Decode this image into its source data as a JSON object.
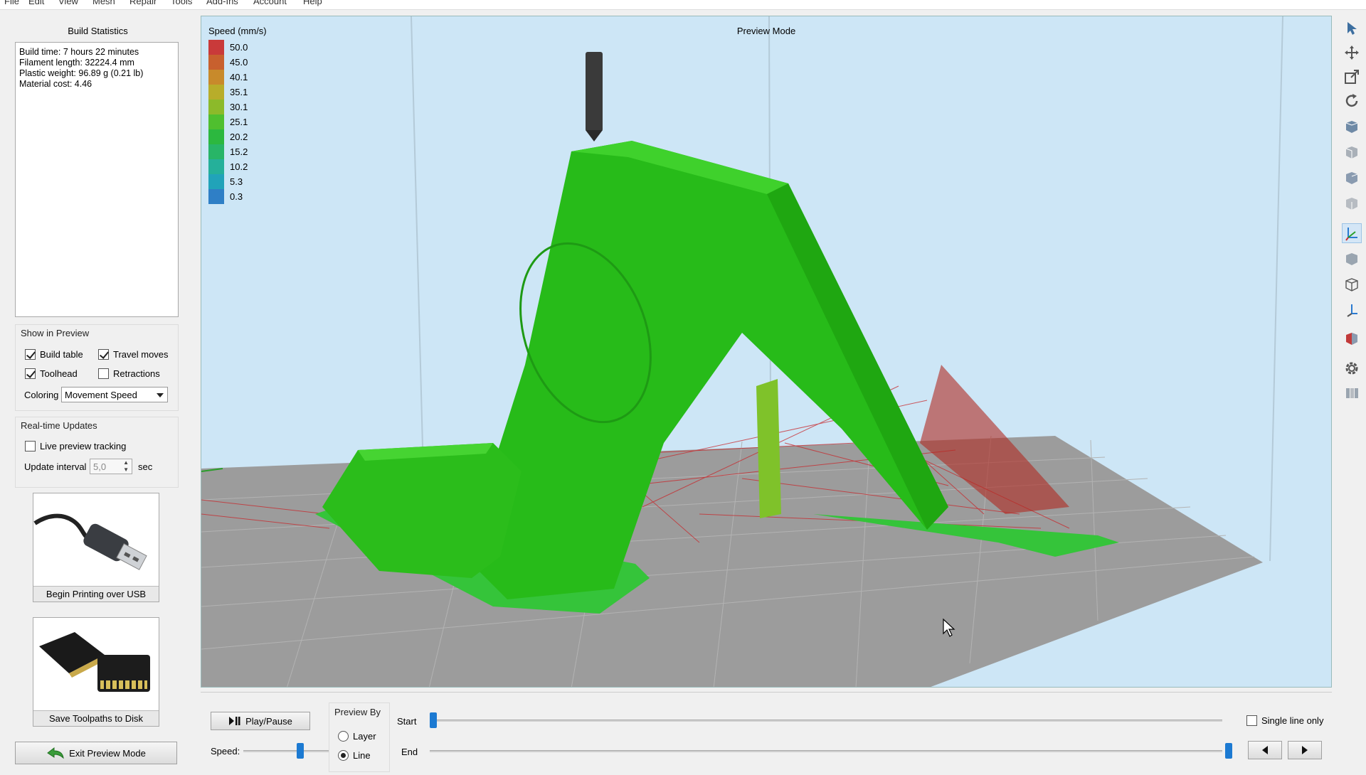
{
  "menu": [
    "File",
    "Edit",
    "View",
    "Mesh",
    "Repair",
    "Tools",
    "Add-Ins",
    "Account",
    "Help"
  ],
  "stats": {
    "title": "Build Statistics",
    "lines": [
      "Build time: 7 hours 22 minutes",
      "Filament length: 32224.4 mm",
      "Plastic weight: 96.89 g (0.21 lb)",
      "Material cost: 4.46"
    ]
  },
  "show_in_preview": {
    "title": "Show in Preview",
    "build_table": "Build table",
    "travel_moves": "Travel moves",
    "toolhead": "Toolhead",
    "retractions": "Retractions",
    "coloring_label": "Coloring",
    "coloring_value": "Movement Speed"
  },
  "realtime": {
    "title": "Real-time Updates",
    "live_tracking": "Live preview tracking",
    "interval_label": "Update interval",
    "interval_value": "5,0",
    "interval_unit": "sec"
  },
  "actions": {
    "usb_label": "Begin Printing over USB",
    "sd_label": "Save Toolpaths to Disk",
    "exit_label": "Exit Preview Mode"
  },
  "viewport": {
    "mode_label": "Preview Mode",
    "legend_title": "Speed (mm/s)",
    "legend": [
      {
        "value": "50.0",
        "color": "#c93a3a"
      },
      {
        "value": "45.0",
        "color": "#c8602e"
      },
      {
        "value": "40.1",
        "color": "#c88a2b"
      },
      {
        "value": "35.1",
        "color": "#b8ad2a"
      },
      {
        "value": "30.1",
        "color": "#8cba2a"
      },
      {
        "value": "25.1",
        "color": "#4fbf2f"
      },
      {
        "value": "20.2",
        "color": "#2cb83f"
      },
      {
        "value": "15.2",
        "color": "#28b567"
      },
      {
        "value": "10.2",
        "color": "#25b09a"
      },
      {
        "value": "5.3",
        "color": "#21a3b9"
      },
      {
        "value": "0.3",
        "color": "#2f7fc6"
      }
    ]
  },
  "bottom": {
    "play_label": "Play/Pause",
    "speed_label": "Speed:",
    "preview_by_title": "Preview By",
    "layer_label": "Layer",
    "line_label": "Line",
    "start_label": "Start",
    "end_label": "End",
    "single_line_label": "Single line only"
  }
}
